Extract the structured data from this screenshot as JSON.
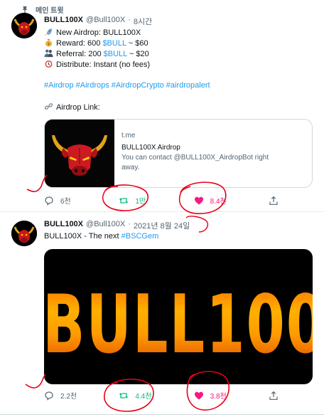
{
  "pinned": {
    "label": "메인 트윗",
    "icon": "pin-icon"
  },
  "tweets": [
    {
      "author": {
        "name": "BULL100X",
        "handle": "@Bull100X",
        "separator": "·",
        "time": "8시간"
      },
      "lines": [
        {
          "emoji": "rocket-icon",
          "parts": [
            "New Airdrop: BULL100X"
          ]
        },
        {
          "emoji": "money-bag-icon",
          "parts": [
            "Reward:  600 ",
            "$BULL",
            " ~ $60"
          ]
        },
        {
          "emoji": "people-icon",
          "parts": [
            "Referral: 200 ",
            "$BULL",
            " ~ $20"
          ]
        },
        {
          "emoji": "alarm-clock-icon",
          "parts": [
            "Distribute: Instant (no fees)"
          ]
        }
      ],
      "hashtags": "#Airdrop #Airdrops #AirdropCrypto #airdropalert",
      "link_line": "Airdrop Link:",
      "card": {
        "domain": "t.me",
        "title": "BULL100X Airdrop",
        "description_1": "You can contact @BULL100X_AirdropBot right",
        "description_2": "away."
      },
      "actions": {
        "replies": "6천",
        "retweets": "1만",
        "likes": "8.4천"
      }
    },
    {
      "author": {
        "name": "BULL100X",
        "handle": "@Bull100X",
        "separator": "·",
        "time": "2021년 8월 24일"
      },
      "text": "BULL100X - The next ",
      "hashtag": "#BSCGem",
      "media_text": "BULL100",
      "actions": {
        "replies": "2.2천",
        "retweets": "4.4천",
        "likes": "3.8천"
      }
    }
  ],
  "colors": {
    "accent": "#1d9bf0",
    "retweet": "#00ba7c",
    "like": "#f91880",
    "annotation": "#e8001a"
  }
}
